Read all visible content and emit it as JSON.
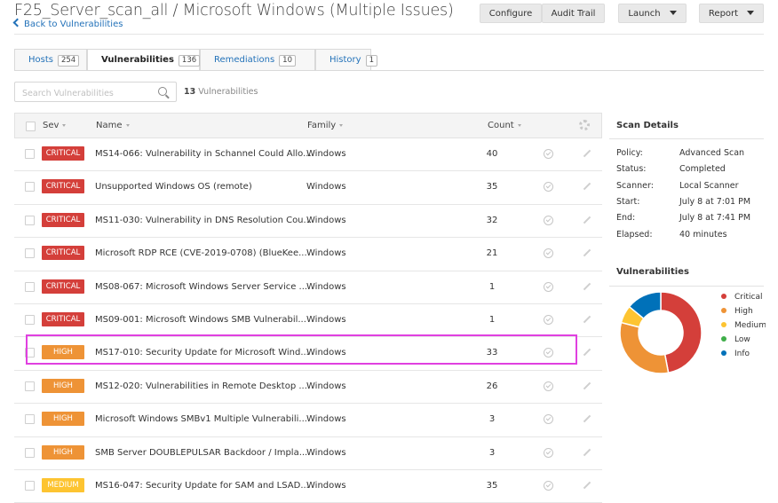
{
  "header": {
    "title": "F25_Server_scan_all / Microsoft Windows (Multiple Issues)",
    "back_link": "Back to Vulnerabilities",
    "buttons": {
      "configure": "Configure",
      "audit_trail": "Audit Trail",
      "launch": "Launch",
      "report": "Report"
    }
  },
  "tabs": [
    {
      "label": "Hosts",
      "count": "254",
      "active": false
    },
    {
      "label": "Vulnerabilities",
      "count": "136",
      "active": true
    },
    {
      "label": "Remediations",
      "count": "10",
      "active": false
    },
    {
      "label": "History",
      "count": "1",
      "active": false
    }
  ],
  "search": {
    "placeholder": "Search Vulnerabilities",
    "result_count": "13",
    "result_label": "Vulnerabilities"
  },
  "table": {
    "columns": {
      "sev": "Sev",
      "name": "Name",
      "family": "Family",
      "count": "Count"
    },
    "rows": [
      {
        "sev": "CRITICAL",
        "name": "MS14-066: Vulnerability in Schannel Could Allo...",
        "family": "Windows",
        "count": "40"
      },
      {
        "sev": "CRITICAL",
        "name": "Unsupported Windows OS (remote)",
        "family": "Windows",
        "count": "35"
      },
      {
        "sev": "CRITICAL",
        "name": "MS11-030: Vulnerability in DNS Resolution Cou...",
        "family": "Windows",
        "count": "32"
      },
      {
        "sev": "CRITICAL",
        "name": "Microsoft RDP RCE (CVE-2019-0708) (BlueKee...",
        "family": "Windows",
        "count": "21"
      },
      {
        "sev": "CRITICAL",
        "name": "MS08-067: Microsoft Windows Server Service ...",
        "family": "Windows",
        "count": "1"
      },
      {
        "sev": "CRITICAL",
        "name": "MS09-001: Microsoft Windows SMB Vulnerabil...",
        "family": "Windows",
        "count": "1"
      },
      {
        "sev": "HIGH",
        "name": "MS17-010: Security Update for Microsoft Wind...",
        "family": "Windows",
        "count": "33"
      },
      {
        "sev": "HIGH",
        "name": "MS12-020: Vulnerabilities in Remote Desktop ...",
        "family": "Windows",
        "count": "26"
      },
      {
        "sev": "HIGH",
        "name": "Microsoft Windows SMBv1 Multiple Vulnerabili...",
        "family": "Windows",
        "count": "3"
      },
      {
        "sev": "HIGH",
        "name": "SMB Server DOUBLEPULSAR Backdoor / Impla...",
        "family": "Windows",
        "count": "3"
      },
      {
        "sev": "MEDIUM",
        "name": "MS16-047: Security Update for SAM and LSAD...",
        "family": "Windows",
        "count": "35"
      }
    ],
    "highlighted_row": 6
  },
  "severity_colors": {
    "CRITICAL": "#d43f3a",
    "HIGH": "#ee9336",
    "MEDIUM": "#fdc431",
    "LOW": "#3fae49",
    "INFO": "#0071b9"
  },
  "scan_details": {
    "title": "Scan Details",
    "items": [
      {
        "label": "Policy:",
        "value": "Advanced Scan"
      },
      {
        "label": "Status:",
        "value": "Completed"
      },
      {
        "label": "Scanner:",
        "value": "Local Scanner"
      },
      {
        "label": "Start:",
        "value": "July 8 at 7:01 PM"
      },
      {
        "label": "End:",
        "value": "July 8 at 7:41 PM"
      },
      {
        "label": "Elapsed:",
        "value": "40 minutes"
      }
    ]
  },
  "vulnerabilities_panel": {
    "title": "Vulnerabilities",
    "legend": [
      {
        "label": "Critical",
        "color": "#d43f3a"
      },
      {
        "label": "High",
        "color": "#ee9336"
      },
      {
        "label": "Medium",
        "color": "#fdc431"
      },
      {
        "label": "Low",
        "color": "#3fae49"
      },
      {
        "label": "Info",
        "color": "#0071b9"
      }
    ],
    "donut_fractions": [
      {
        "label": "Critical",
        "value": 0.47
      },
      {
        "label": "High",
        "value": 0.32
      },
      {
        "label": "Medium",
        "value": 0.07
      },
      {
        "label": "Low",
        "value": 0.0
      },
      {
        "label": "Info",
        "value": 0.14
      }
    ]
  }
}
